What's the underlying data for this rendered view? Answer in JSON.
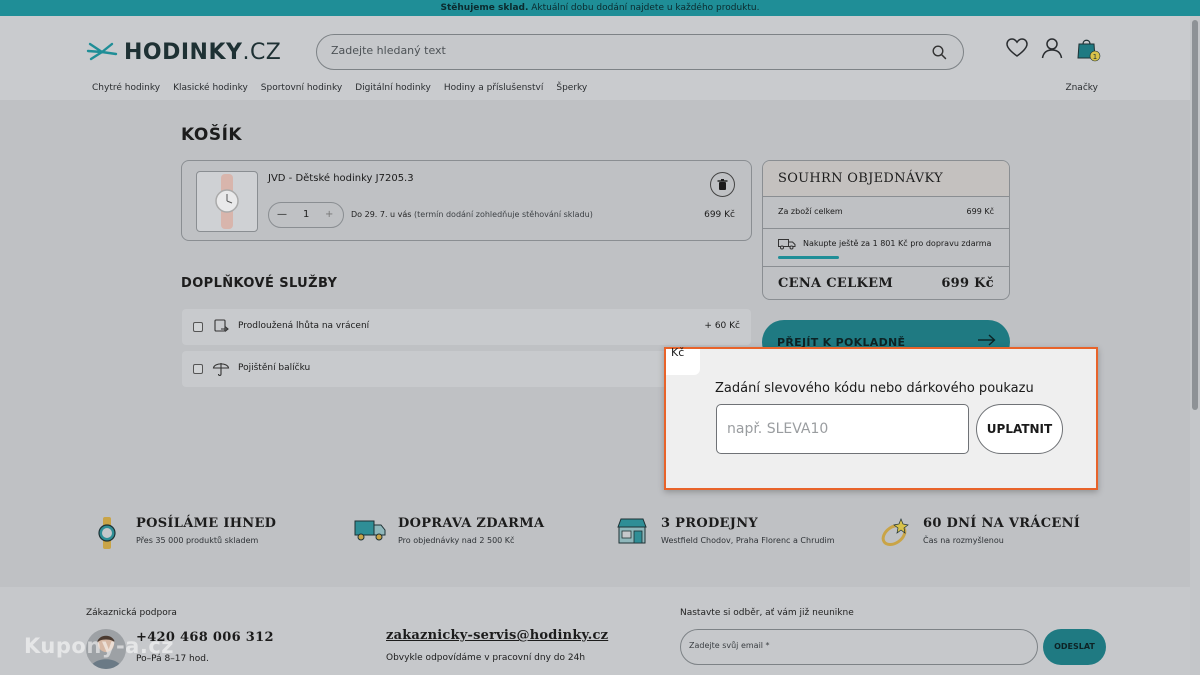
{
  "announcement": {
    "bold": "Stěhujeme sklad.",
    "text": " Aktuální dobu dodání najdete u každého produktu."
  },
  "header": {
    "logo_main": "HODINKY",
    "logo_suffix": ".CZ",
    "search_placeholder": "Zadejte hledaný text",
    "cart_count": "1",
    "categories": [
      "Chytré hodinky",
      "Klasické hodinky",
      "Sportovní hodinky",
      "Digitální hodinky",
      "Hodiny a příslušenství",
      "Šperky"
    ],
    "brands": "Značky"
  },
  "cart": {
    "title": "KOŠÍK",
    "item": {
      "name": "JVD - Dětské hodinky J7205.3",
      "quantity": "1",
      "delivery_bold": "Do 29. 7. u vás",
      "delivery_note": " (termín dodání zohledňuje stěhování skladu)",
      "price": "699 Kč"
    }
  },
  "services": {
    "title": "DOPLŇKOVÉ SLUŽBY",
    "items": [
      {
        "label": "Prodloužená lhůta na vrácení",
        "price": "+ 60 Kč"
      },
      {
        "label": "Pojištění balíčku",
        "price": ""
      }
    ]
  },
  "summary": {
    "title": "SOUHRN OBJEDNÁVKY",
    "goods_label": "Za zboží celkem",
    "goods_value": "699 Kč",
    "shipping_text": "Nakupte ještě za 1 801 Kč pro dopravu zdarma",
    "shipping_progress": 0.28,
    "total_label": "CENA CELKEM",
    "total_value": "699 Kč",
    "checkout_label": "PŘEJÍT K POKLADNĚ"
  },
  "coupon": {
    "tab_text": "Kč",
    "title": "Zadání slevového kódu nebo dárkového poukazu",
    "placeholder": "např. SLEVA10",
    "apply_label": "UPLATNIT",
    "accent": "#e8632a"
  },
  "benefits": [
    {
      "title": "POSÍLÁME IHNED",
      "subtitle": "Přes 35 000 produktů skladem",
      "icon": "watch-icon"
    },
    {
      "title": "DOPRAVA ZDARMA",
      "subtitle": "Pro objednávky nad 2 500 Kč",
      "icon": "delivery-truck-icon"
    },
    {
      "title": "3 PRODEJNY",
      "subtitle": "Westfield Chodov, Praha Florenc a Chrudim",
      "icon": "store-icon"
    },
    {
      "title": "60 DNÍ NA VRÁCENÍ",
      "subtitle": "Čas na rozmyšlenou",
      "icon": "ring-icon"
    }
  ],
  "footer": {
    "support_label": "Zákaznická podpora",
    "phone": "+420 468 006 312",
    "hours": "Po–Pá 8–17 hod.",
    "email": "zakaznicky-servis@hodinky.cz",
    "email_note": "Obvykle odpovídáme v pracovní dny do 24h",
    "newsletter_label": "Nastavte si odběr, ať vám již neunikne",
    "newsletter_placeholder": "Zadejte svůj email *",
    "subscribe_label": "ODESLAT"
  },
  "watermark": "Kupony-a.cz",
  "colors": {
    "brand_teal": "#1f8e97",
    "overlay_bg": "#bfc1c4"
  }
}
